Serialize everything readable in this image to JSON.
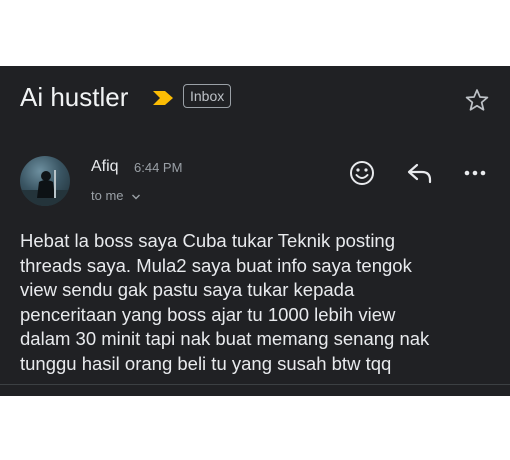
{
  "email": {
    "subject": "Ai hustler",
    "label": "Inbox",
    "sender": "Afiq",
    "time": "6:44 PM",
    "recipient": "to me",
    "body": "Hebat la boss saya Cuba tukar Teknik posting\nthreads saya. Mula2 saya buat info saya tengok\nview sendu gak pastu saya tukar kepada\npenceritaan yang boss ajar tu 1000 lebih view\ndalam 30 minit tapi nak buat memang senang nak\ntunggu hasil orang beli tu yang susah btw tqq"
  },
  "icons": {
    "important": "important-marker-icon",
    "star": "star-icon",
    "emoji": "emoji-reaction-icon",
    "reply": "reply-icon",
    "more": "more-options-icon",
    "expand": "chevron-down-icon"
  },
  "colors": {
    "background": "#202124",
    "important_marker": "#fbbc04",
    "text_primary": "#e8eaed",
    "text_secondary": "#9aa0a6"
  }
}
